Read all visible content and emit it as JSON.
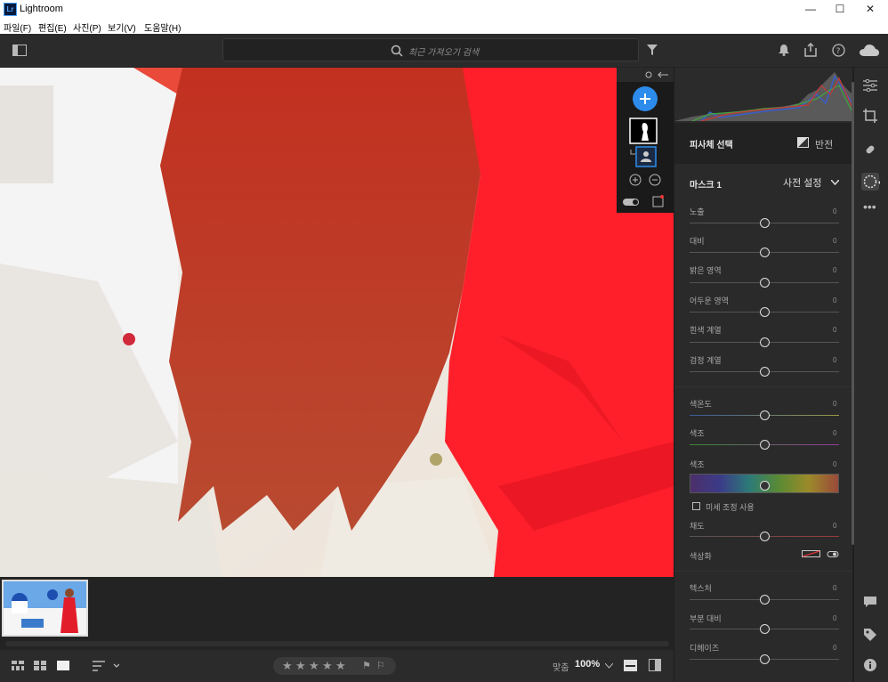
{
  "app": {
    "title": "Lightroom",
    "logo_text": "Lr"
  },
  "menu": [
    "파일(F)",
    "편집(E)",
    "사진(P)",
    "보기(V)",
    "도움말(H)"
  ],
  "search": {
    "placeholder": "최근 가져오기 검색"
  },
  "panel": {
    "subject_title": "피사체 선택",
    "invert_label": "반전",
    "mask_name": "마스크 1",
    "preset_label": "사전 설정",
    "sliders": [
      {
        "label": "노출",
        "value": "0"
      },
      {
        "label": "대비",
        "value": "0"
      },
      {
        "label": "밝은 영역",
        "value": "0"
      },
      {
        "label": "어두운 영역",
        "value": "0"
      },
      {
        "label": "흰색 계열",
        "value": "0"
      },
      {
        "label": "검정 계열",
        "value": "0"
      }
    ],
    "color_sliders": [
      {
        "label": "색온도",
        "value": "0"
      },
      {
        "label": "색조",
        "value": "0"
      }
    ],
    "hue": {
      "label": "색조",
      "value": "0"
    },
    "fine_tune_label": "미세 조정 사용",
    "saturation": {
      "label": "채도",
      "value": "0"
    },
    "colorize_label": "색상화",
    "effects": [
      {
        "label": "텍스처",
        "value": "0"
      },
      {
        "label": "부분 대비",
        "value": "0"
      },
      {
        "label": "디헤이즈",
        "value": "0"
      }
    ]
  },
  "bottom": {
    "zoom_label": "맞춤",
    "zoom_value": "100%"
  },
  "colors": {
    "accent": "#2d8ceb",
    "mask_overlay": "#ff1f2b"
  }
}
